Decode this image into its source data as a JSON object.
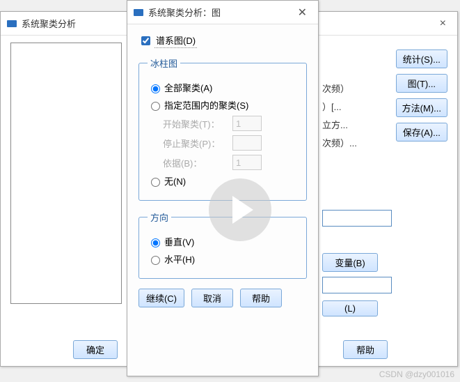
{
  "main_window": {
    "title": "系统聚类分析",
    "partial_items": [
      "次频）",
      "）[...",
      "立方...",
      "次频）..."
    ],
    "buttons": {
      "stats": "统计(S)...",
      "plot": "图(T)...",
      "method": "方法(M)...",
      "save": "保存(A)..."
    },
    "mid_buttons": {
      "variable": "变量(B)",
      "label": "(L)"
    },
    "bottom": {
      "ok": "确定",
      "help": "帮助"
    }
  },
  "dialog": {
    "title": "系统聚类分析：图",
    "dendrogram": "谱系图(D)",
    "icicle": {
      "legend": "冰柱图",
      "all": "全部聚类(A)",
      "range": "指定范围内的聚类(S)",
      "start_label": "开始聚类(T)：",
      "start_value": "1",
      "stop_label": "停止聚类(P)：",
      "stop_value": "",
      "by_label": "依据(B)：",
      "by_value": "1",
      "none": "无(N)"
    },
    "orientation": {
      "legend": "方向",
      "vertical": "垂直(V)",
      "horizontal": "水平(H)"
    },
    "buttons": {
      "continue": "继续(C)",
      "cancel": "取消",
      "help": "帮助"
    }
  },
  "watermark": "CSDN @dzy001016"
}
